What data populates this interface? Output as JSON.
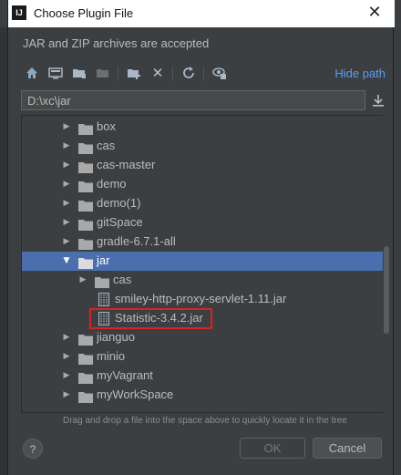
{
  "window": {
    "title": "Choose Plugin File",
    "app_icon_text": "IJ"
  },
  "subtitle": "JAR and ZIP archives are accepted",
  "toolbar": {
    "buttons": [
      "home-icon",
      "desktop-icon",
      "new-folder-icon",
      "project-icon",
      "module-icon",
      "delete-icon",
      "refresh-icon",
      "show-hidden-icon"
    ],
    "hide_path_label": "Hide path"
  },
  "path": {
    "value": "D:\\xc\\jar"
  },
  "tree": {
    "items": [
      {
        "label": "box",
        "type": "folder",
        "expanded": false,
        "depth": 0
      },
      {
        "label": "cas",
        "type": "folder",
        "expanded": false,
        "depth": 0
      },
      {
        "label": "cas-master",
        "type": "folder",
        "expanded": false,
        "depth": 0
      },
      {
        "label": "demo",
        "type": "folder",
        "expanded": false,
        "depth": 0
      },
      {
        "label": "demo(1)",
        "type": "folder",
        "expanded": false,
        "depth": 0
      },
      {
        "label": "gitSpace",
        "type": "folder",
        "expanded": false,
        "depth": 0
      },
      {
        "label": "gradle-6.7.1-all",
        "type": "folder",
        "expanded": false,
        "depth": 0
      },
      {
        "label": "jar",
        "type": "folder",
        "expanded": true,
        "depth": 0,
        "selected": true
      },
      {
        "label": "cas",
        "type": "folder",
        "expanded": false,
        "depth": 1
      },
      {
        "label": "smiley-http-proxy-servlet-1.11.jar",
        "type": "jar",
        "depth": 1
      },
      {
        "label": "Statistic-3.4.2.jar",
        "type": "jar",
        "depth": 1,
        "highlighted": true
      },
      {
        "label": "jianguo",
        "type": "folder",
        "expanded": false,
        "depth": 0
      },
      {
        "label": "minio",
        "type": "folder",
        "expanded": false,
        "depth": 0
      },
      {
        "label": "myVagrant",
        "type": "folder",
        "expanded": false,
        "depth": 0
      },
      {
        "label": "myWorkSpace",
        "type": "folder",
        "expanded": false,
        "depth": 0
      }
    ]
  },
  "hint": "Drag and drop a file into the space above to quickly locate it in the tree",
  "buttons": {
    "help": "?",
    "ok": "OK",
    "cancel": "Cancel"
  },
  "colors": {
    "background": "#3c3f41",
    "selection": "#4b6eaf",
    "link": "#589df6",
    "highlight_border": "#e02020"
  }
}
